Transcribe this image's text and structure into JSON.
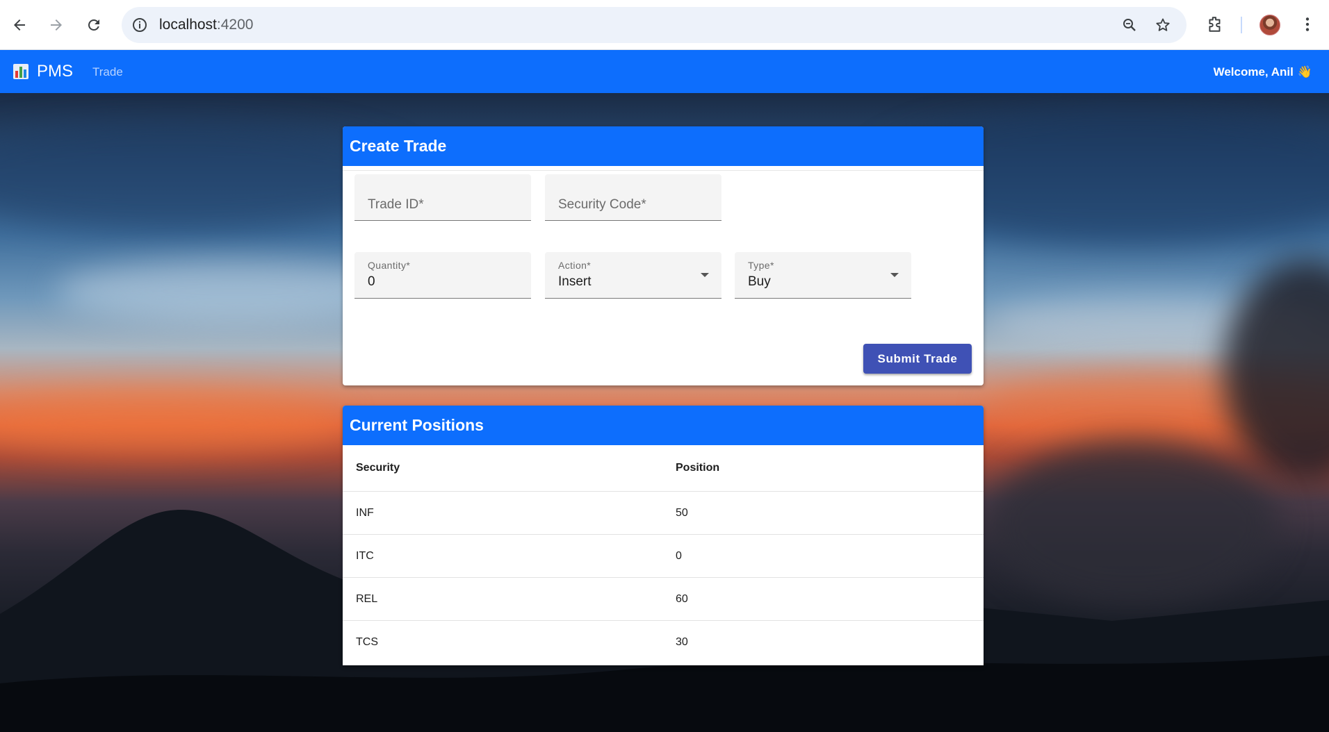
{
  "browser": {
    "url_host": "localhost",
    "url_port": ":4200",
    "icons": [
      "back-arrow-icon",
      "forward-arrow-icon",
      "reload-icon",
      "site-info-icon",
      "zoom-icon",
      "bookmark-star-icon",
      "extensions-icon",
      "profile-avatar",
      "kebab-menu-icon"
    ]
  },
  "header": {
    "brand": "PMS",
    "nav_trade": "Trade",
    "welcome": "Welcome, Anil",
    "wave": "👋",
    "color": "#0d6efd"
  },
  "trade_form": {
    "title": "Create Trade",
    "trade_id_label": "Trade ID*",
    "security_code_label": "Security Code*",
    "quantity_label": "Quantity*",
    "quantity_value": "0",
    "action_label": "Action*",
    "action_value": "Insert",
    "type_label": "Type*",
    "type_value": "Buy",
    "submit_label": "Submit Trade",
    "submit_color": "#3f51b5"
  },
  "positions": {
    "title": "Current Positions",
    "columns": [
      "Security",
      "Position"
    ],
    "rows": [
      [
        "INF",
        "50"
      ],
      [
        "ITC",
        "0"
      ],
      [
        "REL",
        "60"
      ],
      [
        "TCS",
        "30"
      ]
    ]
  }
}
